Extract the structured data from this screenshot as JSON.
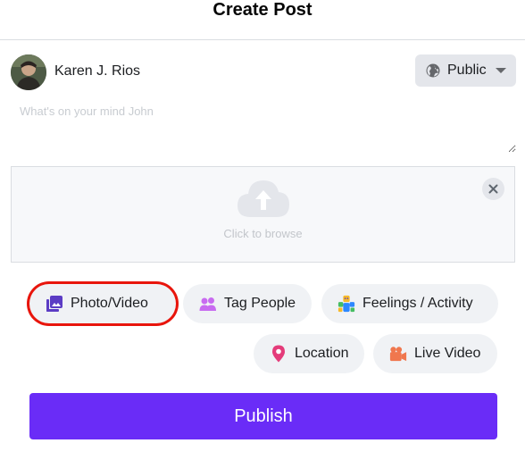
{
  "dialog": {
    "title": "Create Post"
  },
  "author": {
    "name": "Karen J. Rios"
  },
  "audience": {
    "label": "Public",
    "icon": "globe-icon"
  },
  "composer": {
    "placeholder": "What's on your mind John",
    "value": ""
  },
  "upload": {
    "hint": "Click to browse",
    "icon": "cloud-upload-icon"
  },
  "actions": {
    "photo": {
      "label": "Photo/Video",
      "icon": "photo-icon",
      "color": "#5b3cc4"
    },
    "tag": {
      "label": "Tag People",
      "icon": "people-icon",
      "color": "#c86bf0"
    },
    "feelings": {
      "label": "Feelings / Activity",
      "icon": "feelings-icon"
    },
    "location": {
      "label": "Location",
      "icon": "location-pin-icon",
      "color": "#e43c7a"
    },
    "live": {
      "label": "Live Video",
      "icon": "video-camera-icon",
      "color": "#f0774e"
    }
  },
  "publish": {
    "label": "Publish",
    "color": "#6a2cf7"
  }
}
